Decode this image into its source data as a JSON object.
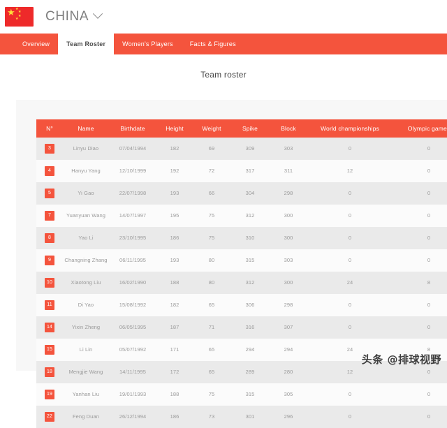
{
  "header": {
    "country": "CHINA",
    "flag_icon": "china-flag-icon",
    "chevron_icon": "chevron-down-icon"
  },
  "tabs": [
    {
      "label": "Overview",
      "active": false
    },
    {
      "label": "Team Roster",
      "active": true
    },
    {
      "label": "Women's Players",
      "active": false
    },
    {
      "label": "Facts & Figures",
      "active": false
    }
  ],
  "page_title": "Team roster",
  "table": {
    "columns": [
      "N°",
      "Name",
      "Birthdate",
      "Height",
      "Weight",
      "Spike",
      "Block",
      "World championships",
      "Olympic games"
    ],
    "rows": [
      {
        "num": "3",
        "name": "Linyu Diao",
        "birthdate": "07/04/1994",
        "height": "182",
        "weight": "69",
        "spike": "309",
        "block": "303",
        "world_championships": "0",
        "olympic_games": "0"
      },
      {
        "num": "4",
        "name": "Hanyu Yang",
        "birthdate": "12/10/1999",
        "height": "192",
        "weight": "72",
        "spike": "317",
        "block": "311",
        "world_championships": "12",
        "olympic_games": "0"
      },
      {
        "num": "5",
        "name": "Yi Gao",
        "birthdate": "22/07/1998",
        "height": "193",
        "weight": "66",
        "spike": "304",
        "block": "298",
        "world_championships": "0",
        "olympic_games": "0"
      },
      {
        "num": "7",
        "name": "Yuanyuan Wang",
        "birthdate": "14/07/1997",
        "height": "195",
        "weight": "75",
        "spike": "312",
        "block": "300",
        "world_championships": "0",
        "olympic_games": "0"
      },
      {
        "num": "8",
        "name": "Yao Li",
        "birthdate": "23/10/1995",
        "height": "186",
        "weight": "75",
        "spike": "310",
        "block": "300",
        "world_championships": "0",
        "olympic_games": "0"
      },
      {
        "num": "9",
        "name": "Changning Zhang",
        "birthdate": "06/11/1995",
        "height": "193",
        "weight": "80",
        "spike": "315",
        "block": "303",
        "world_championships": "0",
        "olympic_games": "0"
      },
      {
        "num": "10",
        "name": "Xiaotong Liu",
        "birthdate": "16/02/1990",
        "height": "188",
        "weight": "80",
        "spike": "312",
        "block": "300",
        "world_championships": "24",
        "olympic_games": "8"
      },
      {
        "num": "11",
        "name": "Di Yao",
        "birthdate": "15/08/1992",
        "height": "182",
        "weight": "65",
        "spike": "306",
        "block": "298",
        "world_championships": "0",
        "olympic_games": "0"
      },
      {
        "num": "14",
        "name": "Yixin Zheng",
        "birthdate": "06/05/1995",
        "height": "187",
        "weight": "71",
        "spike": "316",
        "block": "307",
        "world_championships": "0",
        "olympic_games": "0"
      },
      {
        "num": "15",
        "name": "Li Lin",
        "birthdate": "05/07/1992",
        "height": "171",
        "weight": "65",
        "spike": "294",
        "block": "294",
        "world_championships": "24",
        "olympic_games": "8"
      },
      {
        "num": "18",
        "name": "Mengjie Wang",
        "birthdate": "14/11/1995",
        "height": "172",
        "weight": "65",
        "spike": "289",
        "block": "280",
        "world_championships": "12",
        "olympic_games": "0"
      },
      {
        "num": "19",
        "name": "Yanhan Liu",
        "birthdate": "19/01/1993",
        "height": "188",
        "weight": "75",
        "spike": "315",
        "block": "305",
        "world_championships": "0",
        "olympic_games": "0"
      },
      {
        "num": "22",
        "name": "Feng Duan",
        "birthdate": "26/12/1994",
        "height": "186",
        "weight": "73",
        "spike": "301",
        "block": "296",
        "world_championships": "0",
        "olympic_games": "0"
      }
    ]
  },
  "watermark": "头条 @排球视野",
  "colors": {
    "accent_red": "#f4543d",
    "flag_red": "#ee2a2a",
    "flag_star": "#ffde3a",
    "card_bg": "#f7f7f7",
    "row_odd": "#eaeaea",
    "row_even": "#fbfbfb"
  }
}
